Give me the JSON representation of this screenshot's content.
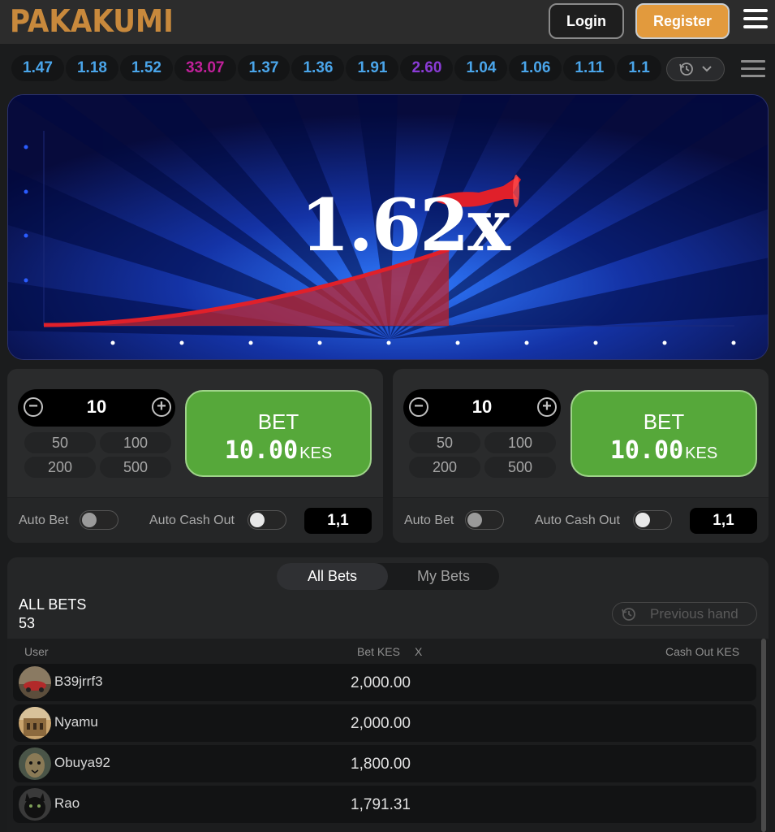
{
  "header": {
    "logo": "PAKAKUMI",
    "login_label": "Login",
    "register_label": "Register",
    "menu_icon": "hamburger-icon"
  },
  "multipliers": [
    {
      "value": "1.47",
      "color": "#4aa5ea"
    },
    {
      "value": "1.18",
      "color": "#4aa5ea"
    },
    {
      "value": "1.52",
      "color": "#4aa5ea"
    },
    {
      "value": "33.07",
      "color": "#c0209a"
    },
    {
      "value": "1.37",
      "color": "#4aa5ea"
    },
    {
      "value": "1.36",
      "color": "#4aa5ea"
    },
    {
      "value": "1.91",
      "color": "#4aa5ea"
    },
    {
      "value": "2.60",
      "color": "#8a3bd6"
    },
    {
      "value": "1.04",
      "color": "#4aa5ea"
    },
    {
      "value": "1.06",
      "color": "#4aa5ea"
    },
    {
      "value": "1.11",
      "color": "#4aa5ea"
    },
    {
      "value": "1.1",
      "color": "#4aa5ea"
    }
  ],
  "game": {
    "multiplier": "1.62x"
  },
  "bet_panels": [
    {
      "stake": "10",
      "quick_amounts": [
        "50",
        "100",
        "200",
        "500"
      ],
      "bet_label": "BET",
      "bet_amount": "10.00",
      "currency": "KES",
      "auto_bet_label": "Auto Bet",
      "auto_cashout_label": "Auto Cash Out",
      "cashout_value": "1,1"
    },
    {
      "stake": "10",
      "quick_amounts": [
        "50",
        "100",
        "200",
        "500"
      ],
      "bet_label": "BET",
      "bet_amount": "10.00",
      "currency": "KES",
      "auto_bet_label": "Auto Bet",
      "auto_cashout_label": "Auto Cash Out",
      "cashout_value": "1,1"
    }
  ],
  "bets": {
    "tabs": [
      "All Bets",
      "My Bets"
    ],
    "title": "ALL BETS",
    "count": "53",
    "previous_hand_label": "Previous hand",
    "columns": {
      "user": "User",
      "bet": "Bet KES",
      "x": "X",
      "cashout": "Cash Out KES"
    },
    "rows": [
      {
        "user": "B39jrrf3",
        "bet": "2,000.00"
      },
      {
        "user": "Nyamu",
        "bet": "2,000.00"
      },
      {
        "user": "Obuya92",
        "bet": "1,800.00"
      },
      {
        "user": "Rao",
        "bet": "1,791.31"
      }
    ]
  }
}
